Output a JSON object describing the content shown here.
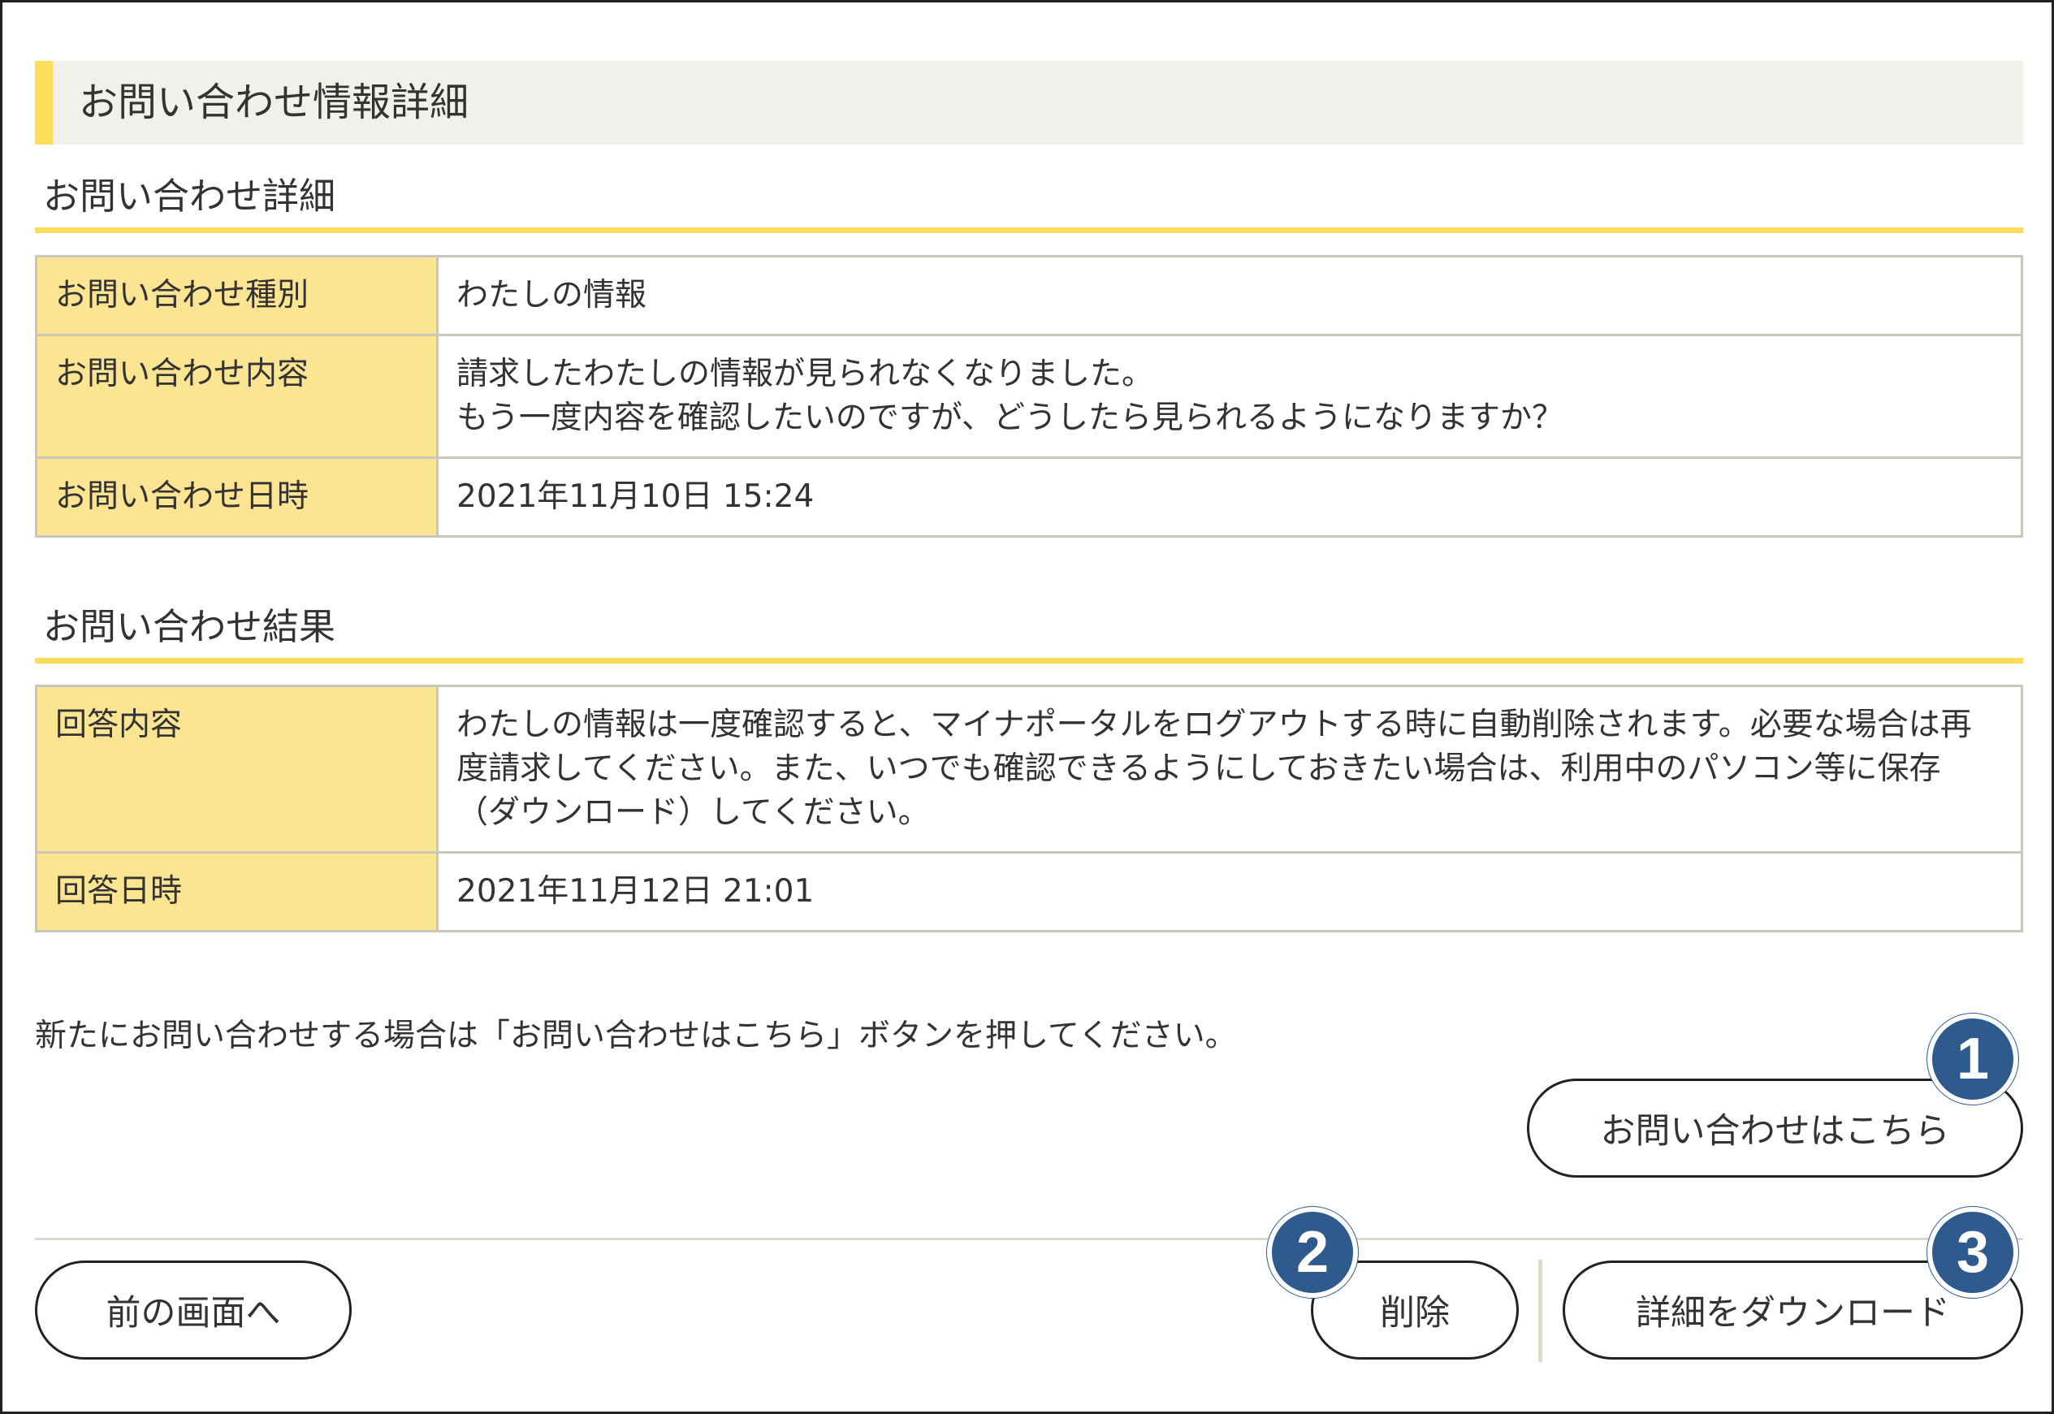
{
  "page_title": "お問い合わせ情報詳細",
  "inquiry_section": {
    "title": "お問い合わせ詳細",
    "rows": [
      {
        "label": "お問い合わせ種別",
        "lines": [
          "わたしの情報"
        ]
      },
      {
        "label": "お問い合わせ内容",
        "lines": [
          "請求したわたしの情報が見られなくなりました。",
          "もう一度内容を確認したいのですが、どうしたら見られるようになりますか？"
        ]
      },
      {
        "label": "お問い合わせ日時",
        "lines": [
          "2021年11月10日 15:24"
        ]
      }
    ]
  },
  "result_section": {
    "title": "お問い合わせ結果",
    "rows": [
      {
        "label": "回答内容",
        "lines": [
          "わたしの情報は一度確認すると、マイナポータルをログアウトする時に自動削除されます。必要な場合は再",
          "度請求してください。また、いつでも確認できるようにしておきたい場合は、利用中のパソコン等に保存",
          "（ダウンロード）してください。"
        ]
      },
      {
        "label": "回答日時",
        "lines": [
          "2021年11月12日 21:01"
        ]
      }
    ]
  },
  "note": "新たにお問い合わせする場合は「お問い合わせはこちら」ボタンを押してください。",
  "buttons": {
    "new_inquiry": "お問い合わせはこちら",
    "back": "前の画面へ",
    "delete": "削除",
    "download": "詳細をダウンロード"
  },
  "badges": [
    "1",
    "2",
    "3"
  ],
  "colors": {
    "accent_yellow": "#fcdc5a",
    "header_cell": "#fbe592",
    "badge_blue": "#2e5a8e"
  }
}
